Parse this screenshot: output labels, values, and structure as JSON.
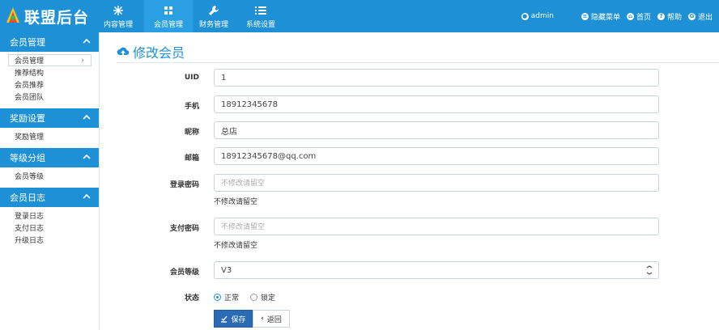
{
  "brand": {
    "title": "联盟后台"
  },
  "topnav": [
    {
      "label": "内容管理",
      "icon": "snowflake-icon"
    },
    {
      "label": "会员管理",
      "icon": "grid-icon"
    },
    {
      "label": "财务管理",
      "icon": "wrench-icon"
    },
    {
      "label": "系统设置",
      "icon": "list-icon"
    }
  ],
  "topright": {
    "admin": "admin",
    "hide_menu": "隐藏菜单",
    "home": "首页",
    "help": "帮助",
    "logout": "退出"
  },
  "sidebar": {
    "groups": [
      {
        "title": "会员管理",
        "items": [
          "会员管理",
          "推荐结构",
          "会员推荐",
          "会员团队"
        ]
      },
      {
        "title": "奖励设置",
        "items": [
          "奖励管理"
        ]
      },
      {
        "title": "等级分组",
        "items": [
          "会员等级"
        ]
      },
      {
        "title": "会员日志",
        "items": [
          "登录日志",
          "支付日志",
          "升级日志"
        ]
      }
    ]
  },
  "page": {
    "title": "修改会员"
  },
  "form": {
    "uid": {
      "label": "UID",
      "value": "1"
    },
    "phone": {
      "label": "手机",
      "value": "18912345678"
    },
    "nickname": {
      "label": "昵称",
      "value": "总店"
    },
    "email": {
      "label": "邮箱",
      "value": "18912345678@qq.com"
    },
    "login_password": {
      "label": "登录密码",
      "placeholder": "不修改请留空",
      "help": "不修改请留空"
    },
    "pay_password": {
      "label": "支付密码",
      "placeholder": "不修改请留空",
      "help": "不修改请留空"
    },
    "level": {
      "label": "会员等级",
      "value": "V3"
    },
    "status": {
      "label": "状态",
      "options": [
        "正常",
        "锁定"
      ],
      "selected": "正常"
    },
    "save_label": "保存",
    "back_label": "返回"
  },
  "colors": {
    "primary": "#1e91d6",
    "save_button": "#2b6bb6"
  }
}
